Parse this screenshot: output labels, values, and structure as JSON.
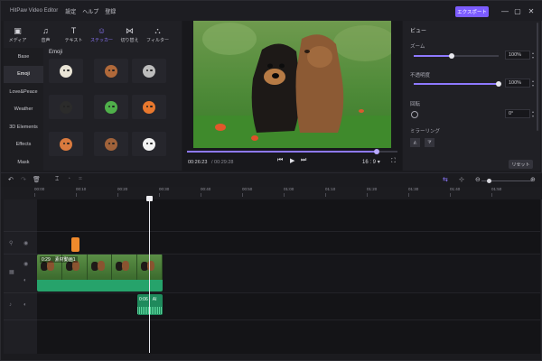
{
  "app": {
    "title": "HitPaw Video Editor",
    "menu": [
      "設定",
      "ヘルプ",
      "登録"
    ],
    "export_label": "エクスポート"
  },
  "toolbar": {
    "tools": [
      {
        "label": "メディア",
        "icon": "media-icon"
      },
      {
        "label": "音声",
        "icon": "music-note-icon"
      },
      {
        "label": "テキスト",
        "icon": "text-icon"
      },
      {
        "label": "ステッカー",
        "icon": "sticker-icon",
        "active": true
      },
      {
        "label": "切り替え",
        "icon": "transition-icon"
      },
      {
        "label": "フィルター",
        "icon": "filter-icon"
      }
    ]
  },
  "sticker_panel": {
    "categories": [
      "Base",
      "Emoji",
      "Love&Peace",
      "Weather",
      "3D Elements",
      "Effects",
      "Mask"
    ],
    "active_category": "Emoji",
    "heading": "Emoji",
    "stickers": [
      {
        "name": "cat-face",
        "color": "#e9e4d6"
      },
      {
        "name": "bear-face",
        "color": "#b0693a"
      },
      {
        "name": "cat-face-gray",
        "color": "#bdbdbd"
      },
      {
        "name": "penguin-face",
        "color": "#2b2b2b"
      },
      {
        "name": "frog-face",
        "color": "#4fb04a"
      },
      {
        "name": "fox-face",
        "color": "#e8782e"
      },
      {
        "name": "monkey-face",
        "color": "#d97a3e"
      },
      {
        "name": "bear-face-2",
        "color": "#a0623a"
      },
      {
        "name": "panda-face",
        "color": "#f2f2f2"
      }
    ]
  },
  "preview": {
    "current_time": "00:26:23",
    "total_time": "/ 00:29:28",
    "progress": 0.9,
    "aspect_ratio": "16 : 9",
    "aspect_caret": "▾"
  },
  "properties": {
    "title": "ビュー",
    "zoom_label": "ズーム",
    "zoom_value": "100%",
    "zoom_level": 0.45,
    "opacity_label": "不透明度",
    "opacity_value": "100%",
    "opacity_level": 1.0,
    "rotation_label": "回転",
    "rotation_value": "0°",
    "mirror_label": "ミラーリング",
    "reset_label": "リセット"
  },
  "timeline": {
    "ruler_ticks": [
      "00:00",
      "00:10",
      "00:20",
      "00:30",
      "00:40",
      "00:50",
      "01:00",
      "01:10",
      "01:20",
      "01:30",
      "01:40",
      "01:50"
    ],
    "video_clip_label": "0:29　素材動画1",
    "audio_clip_label": "0:06　AI",
    "colors": {
      "accent": "#7c5cff",
      "video_clip": "#26a36b",
      "sticker_clip": "#f08a2c"
    }
  }
}
